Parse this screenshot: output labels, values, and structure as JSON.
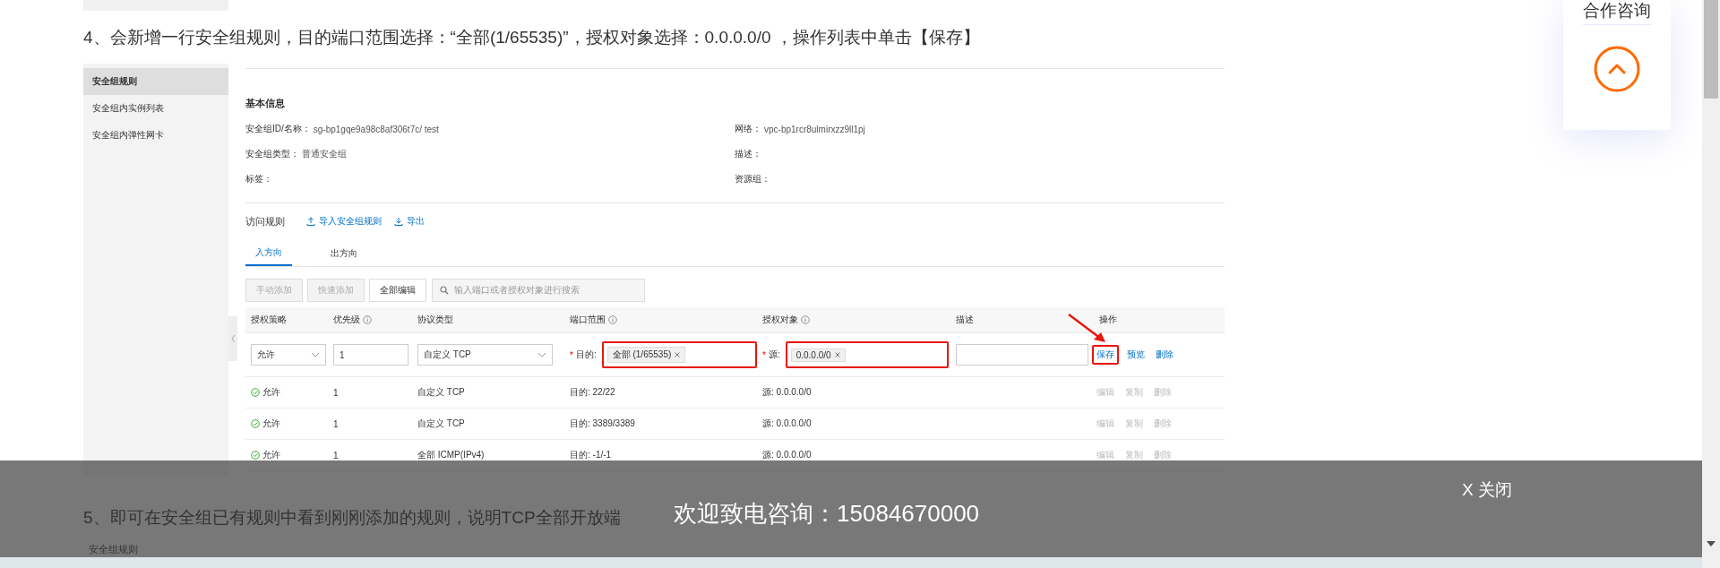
{
  "side_panel": {
    "title": "合作咨询"
  },
  "step4": {
    "text": "4、会新增一行安全组规则，目的端口范围选择：“全部(1/65535)”，授权对象选择：0.0.0.0/0 ，操作列表中单击【保存】"
  },
  "console": {
    "sidebar": {
      "items": [
        {
          "label": "安全组规则",
          "selected": true
        },
        {
          "label": "安全组内实例列表",
          "selected": false
        },
        {
          "label": "安全组内弹性网卡",
          "selected": false
        }
      ]
    },
    "basic_info": {
      "title": "基本信息",
      "fields": [
        {
          "label": "安全组ID/名称：",
          "value": "sg-bp1gqe9a98c8af306t7c/ test"
        },
        {
          "label": "网络：",
          "value": "vpc-bp1rcr8ulmirxzz9ll1pj"
        },
        {
          "label": "安全组类型：",
          "value": "普通安全组"
        },
        {
          "label": "描述："
        },
        {
          "label": "标签："
        },
        {
          "label": "资源组："
        }
      ]
    },
    "rules": {
      "title": "访问规则",
      "links": [
        {
          "label": "导入安全组规则",
          "kind": "upload"
        },
        {
          "label": "导出",
          "kind": "download"
        }
      ],
      "tabs": [
        {
          "label": "入方向",
          "selected": true
        },
        {
          "label": "出方向",
          "selected": false
        }
      ],
      "buttons": [
        {
          "label": "手动添加",
          "disabled": true
        },
        {
          "label": "快速添加",
          "disabled": true
        },
        {
          "label": "全部编辑",
          "disabled": false
        }
      ],
      "search": {
        "placeholder": "输入端口或者授权对象进行搜索"
      },
      "columns": [
        {
          "label": "授权策略",
          "info": false
        },
        {
          "label": "优先级",
          "info": true
        },
        {
          "label": "协议类型",
          "info": false
        },
        {
          "label": "端口范围",
          "info": true
        },
        {
          "label": "授权对象",
          "info": true
        },
        {
          "label": "描述",
          "info": false
        },
        {
          "label": "操作",
          "info": false
        }
      ],
      "edit_row": {
        "policy": "允许",
        "priority": "1",
        "protocol": "自定义 TCP",
        "port": {
          "required_mark": "*",
          "label": "目的:",
          "tag": "全部 (1/65535)",
          "highlighted": true
        },
        "source": {
          "required_mark": "*",
          "label": "源:",
          "tag": "0.0.0.0/0",
          "highlighted": true
        },
        "actions": [
          {
            "label": "保存",
            "highlighted": true
          },
          {
            "label": "预览",
            "highlighted": false
          },
          {
            "label": "删除",
            "highlighted": false
          }
        ]
      },
      "rows": [
        {
          "policy": "允许",
          "priority": "1",
          "protocol": "自定义 TCP",
          "port": "目的: 22/22",
          "source": "源: 0.0.0.0/0",
          "actions": [
            "编辑",
            "复制",
            "删除"
          ]
        },
        {
          "policy": "允许",
          "priority": "1",
          "protocol": "自定义 TCP",
          "port": "目的: 3389/3389",
          "source": "源: 0.0.0.0/0",
          "actions": [
            "编辑",
            "复制",
            "删除"
          ]
        },
        {
          "policy": "允许",
          "priority": "1",
          "protocol": "全部 ICMP(IPv4)",
          "port": "目的: -1/-1",
          "source": "源: 0.0.0.0/0",
          "actions": [
            "编辑",
            "复制",
            "删除"
          ]
        }
      ]
    }
  },
  "step5": {
    "text": "5、即可在安全组已有规则中看到刚刚添加的规则，说明TCP全部开放端",
    "sidebar_item": "安全组规则"
  },
  "consult_banner": {
    "message": "欢迎致电咨询：15084670000",
    "close": "X 关闭"
  }
}
